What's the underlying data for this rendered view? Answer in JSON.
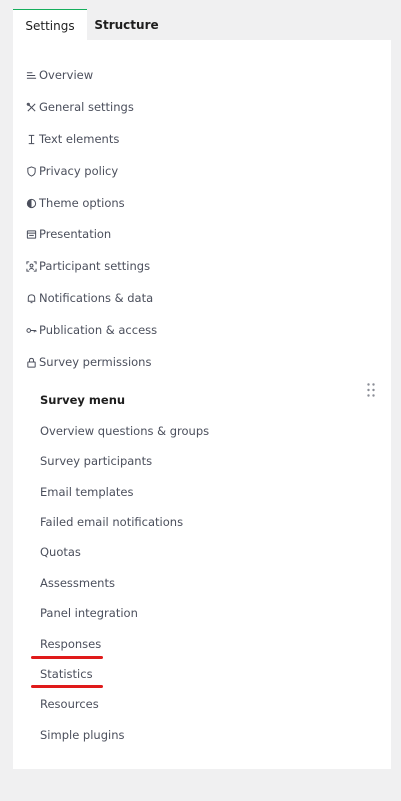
{
  "tabs": {
    "settings_label": "Settings",
    "structure_label": "Structure"
  },
  "settings": {
    "items": [
      {
        "label": "Overview",
        "icon": "list-icon"
      },
      {
        "label": "General settings",
        "icon": "tools-icon"
      },
      {
        "label": "Text elements",
        "icon": "text-cursor-icon"
      },
      {
        "label": "Privacy policy",
        "icon": "shield-icon"
      },
      {
        "label": "Theme options",
        "icon": "half-circle-icon"
      },
      {
        "label": "Presentation",
        "icon": "presentation-icon"
      },
      {
        "label": "Participant settings",
        "icon": "participant-icon"
      },
      {
        "label": "Notifications & data",
        "icon": "bell-icon"
      },
      {
        "label": "Publication & access",
        "icon": "key-icon"
      },
      {
        "label": "Survey permissions",
        "icon": "lock-icon"
      }
    ]
  },
  "survey_menu": {
    "heading": "Survey menu",
    "items": [
      {
        "label": "Overview questions & groups"
      },
      {
        "label": "Survey participants"
      },
      {
        "label": "Email templates"
      },
      {
        "label": "Failed email notifications"
      },
      {
        "label": "Quotas"
      },
      {
        "label": "Assessments"
      },
      {
        "label": "Panel integration"
      },
      {
        "label": "Responses"
      },
      {
        "label": "Statistics"
      },
      {
        "label": "Resources"
      },
      {
        "label": "Simple plugins"
      }
    ]
  },
  "annotation_color": "#e01a1a",
  "accent_color": "#14ae5c"
}
